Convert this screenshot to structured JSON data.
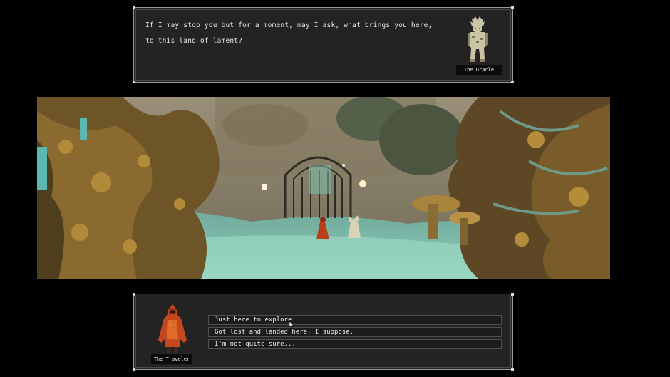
{
  "oracle": {
    "dialogue": "If I may stop you but for a moment, may I ask, what brings you here, to this land of lament?",
    "name": "The Oracle"
  },
  "scene": {
    "description_icon": "forest-gate-scene",
    "colors": {
      "mist": "#7fc2a8",
      "foliage": "#7a5a2a",
      "sky": "#8a8270",
      "cloak": "#b8401c"
    }
  },
  "traveler": {
    "name": "The Traveler"
  },
  "choices": [
    "Just here to explore.",
    "Got lost and landed here, I suppose.",
    "I'm not quite sure..."
  ]
}
